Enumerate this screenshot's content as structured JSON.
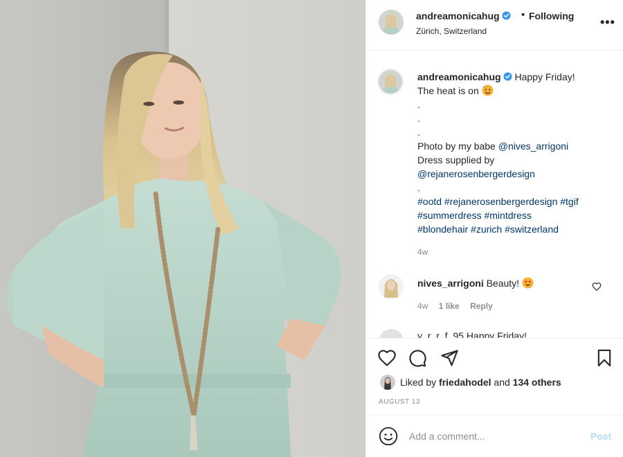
{
  "post": {
    "username": "andreamonicahug",
    "follow_separator": "•",
    "follow_status": "Following",
    "location": "Zürich, Switzerland",
    "more_icon": "more-options-icon"
  },
  "caption": {
    "username": "andreamonicahug",
    "text_first": "Happy Friday!",
    "text_second": "The heat is on",
    "emoji": "hot-face-emoji",
    "dot1": ".",
    "dot2": ".",
    "dot3": ".",
    "photo_by": "Photo by my babe",
    "photo_by_mention": "@nives_arrigoni",
    "dress_supplied": "Dress supplied by",
    "dress_mention": "@rejanerosenbergerdesign",
    "dot4": ".",
    "tags_line1": "#ootd #rejanerosenbergerdesign #tgif",
    "tags_line2": "#summerdress #mintdress",
    "tags_line3": "#blondehair #zurich #switzerland",
    "time": "4w"
  },
  "comment": {
    "username": "nives_arrigoni",
    "text": "Beauty!",
    "emoji": "heart-eyes-emoji",
    "time": "4w",
    "likes": "1 like",
    "reply": "Reply"
  },
  "next_comment_peek": "y_r_r_f_95  Happy Friday!",
  "actions": {
    "like_icon": "heart-icon",
    "comment_icon": "comment-icon",
    "share_icon": "share-icon",
    "save_icon": "bookmark-icon"
  },
  "likes": {
    "prefix": "Liked by",
    "user": "friedahodel",
    "and": "and",
    "others": "134 others"
  },
  "date": "AUGUST 13",
  "add_comment": {
    "placeholder": "Add a comment...",
    "post_label": "Post"
  },
  "colors": {
    "link": "#00376b",
    "muted": "#8e8e8e",
    "verified": "#3897f0",
    "post_disabled": "#b2dffc"
  }
}
